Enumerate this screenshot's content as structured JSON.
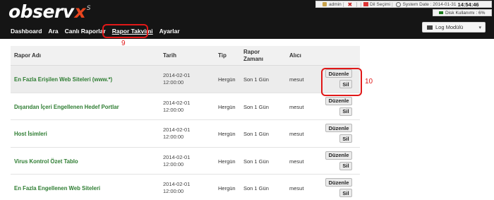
{
  "header": {
    "logo": {
      "word": "observ",
      "mark": "x",
      "suffix": "S"
    },
    "user": {
      "icon": "user-icon",
      "name": "admin",
      "close_icon": "close-icon",
      "language_label": "Dil Seçimi",
      "flag_icon": "flag-icon",
      "clock_icon": "clock-icon",
      "system_date_label": "System Date : 2014-01-31",
      "time": "14:54:46",
      "open_bracket": "[",
      "close_bracket": "]",
      "pipe": "|"
    },
    "disk": {
      "label": "Disk Kullanımı : 6%",
      "icon": "disk-icon"
    },
    "log_module": {
      "label": "Log Modülü",
      "caret": "▾"
    }
  },
  "nav": {
    "items": [
      "Dashboard",
      "Ara",
      "Canlı Raporlar",
      "Rapor Takvimi",
      "Ayarlar"
    ],
    "active_index": 3
  },
  "annotations": {
    "nav_marker": "9",
    "button_marker": "10",
    "color": "#e01818"
  },
  "table": {
    "columns": [
      "Rapor Adı",
      "Tarih",
      "Tip",
      "Rapor Zamanı",
      "Alıcı"
    ],
    "rows": [
      {
        "name": "En Fazla Erişilen Web Siteleri (www.*)",
        "date": "2014-02-01",
        "time": "12:00:00",
        "type": "Hergün",
        "period": "Son 1 Gün",
        "recipient": "mesut"
      },
      {
        "name": "Dışarıdan İçeri Engellenen Hedef Portlar",
        "date": "2014-02-01",
        "time": "12:00:00",
        "type": "Hergün",
        "period": "Son 1 Gün",
        "recipient": "mesut"
      },
      {
        "name": "Host İsimleri",
        "date": "2014-02-01",
        "time": "12:00:00",
        "type": "Hergün",
        "period": "Son 1 Gün",
        "recipient": "mesut"
      },
      {
        "name": "Virus Kontrol Özet Tablo",
        "date": "2014-02-01",
        "time": "12:00:00",
        "type": "Hergün",
        "period": "Son 1 Gün",
        "recipient": "mesut"
      },
      {
        "name": "En Fazla Engellenen Web Siteleri",
        "date": "2014-02-01",
        "time": "12:00:00",
        "type": "Hergün",
        "period": "Son 1 Gün",
        "recipient": "mesut"
      }
    ],
    "edit_label": "Düzenle",
    "delete_label": "Sil"
  },
  "colors": {
    "header_bg": "#151515",
    "link_green": "#2e7d32",
    "logo_accent": "#e8451e"
  }
}
